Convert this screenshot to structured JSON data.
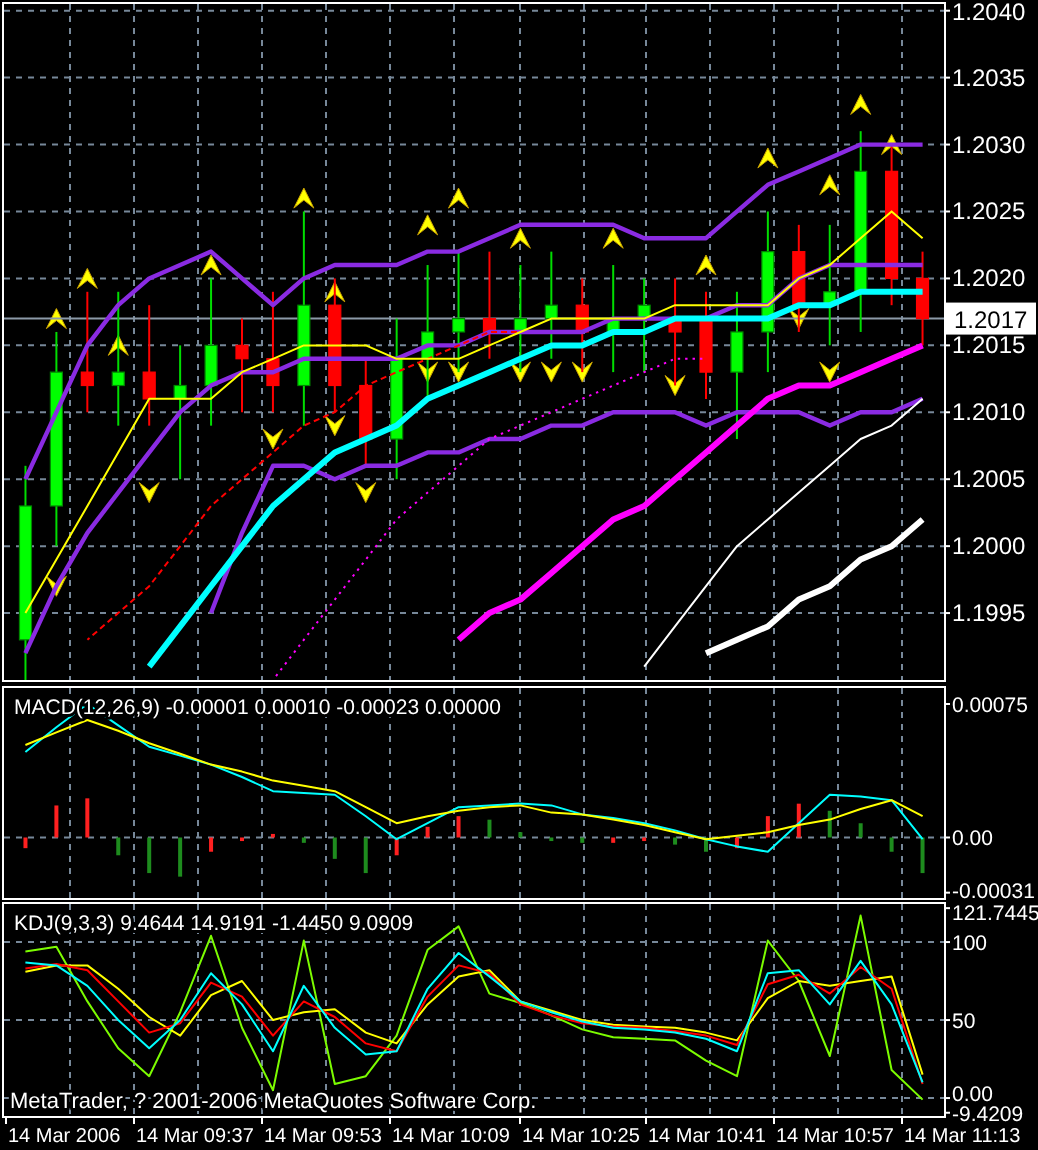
{
  "main_chart": {
    "chart_data": {
      "type": "candlestick",
      "grid": true,
      "ylim": [
        1.199,
        1.20405
      ],
      "categories": [
        null,
        null,
        null,
        null,
        null,
        null,
        null,
        null,
        null,
        null,
        null,
        null,
        null,
        null,
        null,
        null,
        null,
        null,
        null,
        null,
        null,
        null,
        null,
        null,
        null,
        null,
        null,
        null,
        null,
        null
      ],
      "yticks": [
        {
          "value": 1.204,
          "label": "1.2040"
        },
        {
          "value": 1.2035,
          "label": "1.2035"
        },
        {
          "value": 1.203,
          "label": "1.2030"
        },
        {
          "value": 1.2025,
          "label": "1.2025"
        },
        {
          "value": 1.202,
          "label": "1.2020"
        },
        {
          "value": 1.2015,
          "label": "1.2015"
        },
        {
          "value": 1.201,
          "label": "1.2010"
        },
        {
          "value": 1.2005,
          "label": "1.2005"
        },
        {
          "value": 1.2,
          "label": "1.2000"
        },
        {
          "value": 1.1995,
          "label": "1.1995"
        }
      ],
      "series": [
        {
          "ohlc": [
            [
              1.1993,
              1.2006,
              1.199,
              1.2003
            ],
            [
              1.2003,
              1.2016,
              1.2,
              1.2013
            ],
            [
              1.2013,
              1.2019,
              1.201,
              1.2012
            ],
            [
              1.2012,
              1.2019,
              1.2009,
              1.2013
            ],
            [
              1.2013,
              1.2018,
              1.2009,
              1.2011
            ],
            [
              1.2011,
              1.2015,
              1.2005,
              1.2012
            ],
            [
              1.2012,
              1.202,
              1.2009,
              1.2015
            ],
            [
              1.2015,
              1.2017,
              1.201,
              1.2014
            ],
            [
              1.2014,
              1.2019,
              1.201,
              1.2012
            ],
            [
              1.2012,
              1.2025,
              1.2009,
              1.2018
            ],
            [
              1.2018,
              1.202,
              1.201,
              1.2012
            ],
            [
              1.2012,
              1.2014,
              1.2006,
              1.2008
            ],
            [
              1.2008,
              1.2017,
              1.2005,
              1.2014
            ],
            [
              1.2014,
              1.2021,
              1.2011,
              1.2016
            ],
            [
              1.2016,
              1.2022,
              1.2013,
              1.2017
            ],
            [
              1.2017,
              1.2022,
              1.2014,
              1.2016
            ],
            [
              1.2016,
              1.2021,
              1.2013,
              1.2017
            ],
            [
              1.2017,
              1.2022,
              1.2014,
              1.2018
            ],
            [
              1.2018,
              1.202,
              1.2013,
              1.2016
            ],
            [
              1.2016,
              1.2021,
              1.2013,
              1.2017
            ],
            [
              1.2017,
              1.202,
              1.2013,
              1.2018
            ],
            [
              1.2017,
              1.202,
              1.2012,
              1.2016
            ],
            [
              1.2017,
              1.2019,
              1.2011,
              1.2013
            ],
            [
              1.2013,
              1.2019,
              1.2008,
              1.2016
            ],
            [
              1.2016,
              1.2025,
              1.2013,
              1.2022
            ],
            [
              1.2022,
              1.2024,
              1.2016,
              1.2018
            ],
            [
              1.2018,
              1.2024,
              1.2015,
              1.2019
            ],
            [
              1.2019,
              1.2031,
              1.2016,
              1.2028
            ],
            [
              1.2028,
              1.203,
              1.2018,
              1.202
            ],
            [
              1.202,
              1.2022,
              1.2015,
              1.2017
            ]
          ]
        },
        {
          "type": "line",
          "color": "#8a2be2",
          "values": [
            1.2005,
            1.201,
            1.2015,
            1.2018,
            1.202,
            1.2021,
            1.2022,
            1.202,
            1.2018,
            1.202,
            1.2021,
            1.2021,
            1.2021,
            1.2022,
            1.2022,
            1.2023,
            1.2024,
            1.2024,
            1.2024,
            1.2024,
            1.2023,
            1.2023,
            1.2023,
            1.2025,
            1.2027,
            1.2028,
            1.2029,
            1.203,
            1.203,
            1.203
          ]
        },
        {
          "type": "line",
          "color": "#8a2be2",
          "values": [
            1.1992,
            1.1997,
            1.2001,
            1.2004,
            1.2007,
            1.201,
            1.2012,
            1.2013,
            1.2013,
            1.2014,
            1.2014,
            1.2014,
            1.2014,
            1.2015,
            1.2015,
            1.2016,
            1.2016,
            1.2016,
            1.2016,
            1.2017,
            1.2017,
            1.2017,
            1.2017,
            1.2018,
            1.2018,
            1.202,
            1.2021,
            1.2021,
            1.2021,
            1.2021
          ]
        },
        {
          "type": "line",
          "color": "#8a2be2",
          "values": [
            null,
            null,
            null,
            null,
            null,
            null,
            1.1995,
            1.2001,
            1.2006,
            1.2006,
            1.2005,
            1.2006,
            1.2006,
            1.2007,
            1.2007,
            1.2008,
            1.2008,
            1.2009,
            1.2009,
            1.201,
            1.201,
            1.201,
            1.2009,
            1.201,
            1.201,
            1.201,
            1.2009,
            1.201,
            1.201,
            1.2011
          ]
        },
        {
          "type": "line",
          "line_style": "dashed",
          "color": "#ff0000",
          "values": [
            null,
            null,
            1.1993,
            1.1995,
            1.1997,
            1.2,
            1.2003,
            1.2005,
            1.2007,
            1.2009,
            1.201,
            1.2012,
            1.2013,
            1.2014,
            1.2015,
            1.2016,
            1.2016,
            null,
            null,
            null,
            null,
            null,
            null,
            null,
            null,
            null,
            null,
            null,
            null,
            null
          ]
        },
        {
          "type": "line",
          "line_style": "dotted",
          "color": "#ff00ff",
          "values": [
            null,
            null,
            null,
            null,
            null,
            null,
            null,
            null,
            1.199,
            1.1993,
            1.1996,
            1.1999,
            1.2002,
            1.2004,
            1.2006,
            1.2008,
            1.2009,
            1.201,
            1.2011,
            1.2012,
            1.2013,
            1.2014,
            1.2014,
            null,
            null,
            null,
            null,
            null,
            null,
            null
          ]
        },
        {
          "type": "line",
          "color": "#00ffff",
          "values": [
            null,
            null,
            null,
            null,
            1.1991,
            1.1994,
            1.1997,
            1.2,
            1.2003,
            1.2005,
            1.2007,
            1.2008,
            1.2009,
            1.2011,
            1.2012,
            1.2013,
            1.2014,
            1.2015,
            1.2015,
            1.2016,
            1.2016,
            1.2017,
            1.2017,
            1.2017,
            1.2017,
            1.2018,
            1.2018,
            1.2019,
            1.2019,
            1.2019
          ]
        },
        {
          "type": "line",
          "color": "#ff00ff",
          "values": [
            null,
            null,
            null,
            null,
            null,
            null,
            null,
            null,
            null,
            null,
            null,
            null,
            null,
            null,
            1.1993,
            1.1995,
            1.1996,
            1.1998,
            1.2,
            1.2002,
            1.2003,
            1.2005,
            1.2007,
            1.2009,
            1.2011,
            1.2012,
            1.2012,
            1.2013,
            1.2014,
            1.2015
          ]
        },
        {
          "type": "line",
          "color": "#ffffff",
          "values": [
            null,
            null,
            null,
            null,
            null,
            null,
            null,
            null,
            null,
            null,
            null,
            null,
            null,
            null,
            null,
            null,
            null,
            null,
            null,
            null,
            1.1991,
            1.1994,
            1.1997,
            1.2,
            1.2002,
            1.2004,
            1.2006,
            1.2008,
            1.2009,
            1.2011
          ]
        },
        {
          "type": "line",
          "color": "#ffffff",
          "values": [
            null,
            null,
            null,
            null,
            null,
            null,
            null,
            null,
            null,
            null,
            null,
            null,
            null,
            null,
            null,
            null,
            null,
            null,
            null,
            null,
            null,
            null,
            1.1992,
            1.1993,
            1.1994,
            1.1996,
            1.1997,
            1.1999,
            1.2,
            1.2002
          ]
        },
        {
          "type": "line",
          "color": "#ffff00",
          "values": [
            1.1995,
            1.1999,
            1.2003,
            1.2007,
            1.2011,
            1.2011,
            1.2011,
            1.2013,
            1.2014,
            1.2015,
            1.2015,
            1.2015,
            1.2014,
            1.2014,
            1.2014,
            1.2015,
            1.2016,
            1.2017,
            1.2017,
            1.2017,
            1.2017,
            1.2018,
            1.2018,
            1.2018,
            1.2018,
            1.202,
            1.2021,
            1.2023,
            1.2025,
            1.2023
          ]
        },
        {
          "type": "scatter",
          "color": "#ffff00",
          "values": [
            null,
            1.2017,
            1.202,
            1.2015,
            null,
            null,
            1.2021,
            null,
            null,
            1.2026,
            1.2019,
            null,
            null,
            1.2024,
            1.2026,
            null,
            1.2023,
            null,
            null,
            1.2023,
            null,
            null,
            1.2021,
            null,
            1.2029,
            null,
            1.2027,
            1.2033,
            1.203,
            null
          ]
        },
        {
          "type": "scatter",
          "color": "#ffff00",
          "values": [
            null,
            1.1997,
            null,
            null,
            1.2004,
            null,
            null,
            null,
            1.2008,
            null,
            1.2009,
            1.2004,
            null,
            1.2013,
            1.2013,
            null,
            1.2013,
            1.2013,
            1.2013,
            null,
            null,
            1.2012,
            null,
            null,
            null,
            1.2017,
            1.2013,
            null,
            null,
            null
          ]
        }
      ],
      "ref_lines": [
        {
          "axis": "y",
          "value": 1.2017,
          "label": "1.2017",
          "color": "#8c9aa8"
        }
      ]
    }
  },
  "macd_panel": {
    "title": "MACD(12,26,9) -0.00001 0.00010 -0.00023 0.00000",
    "chart_data": {
      "type": "line",
      "grid": true,
      "ylim": [
        -0.00034,
        0.00084
      ],
      "categories": [
        null,
        null,
        null,
        null,
        null,
        null,
        null,
        null,
        null,
        null,
        null,
        null,
        null,
        null,
        null,
        null,
        null,
        null,
        null,
        null,
        null,
        null,
        null,
        null,
        null,
        null,
        null,
        null,
        null,
        null
      ],
      "yticks": [
        {
          "value": 0.00075,
          "label": "0.00075"
        },
        {
          "value": 0,
          "label": "0.00"
        },
        {
          "value": -0.00031,
          "label": "-0.00031"
        }
      ],
      "series": [
        {
          "type": "bar",
          "colors": [
            "#ff2020",
            "#ff2020",
            "#ff2020",
            "#1e8c1e",
            "#1e8c1e",
            "#1e8c1e",
            "#ff2020",
            "#ff2020",
            "#ff2020",
            "#1e8c1e",
            "#1e8c1e",
            "#1e8c1e",
            "#ff2020",
            "#ff2020",
            "#ff2020",
            "#1e8c1e",
            "#1e8c1e",
            "#1e8c1e",
            "#1e8c1e",
            "#ff2020",
            "#ff2020",
            "#1e8c1e",
            "#1e8c1e",
            "#ff2020",
            "#ff2020",
            "#ff2020",
            "#1e8c1e",
            "#1e8c1e",
            "#1e8c1e",
            "#1e8c1e"
          ],
          "values": [
            -6e-05,
            0.00018,
            0.00022,
            -0.0001,
            -0.0002,
            -0.00022,
            -8e-05,
            -2e-05,
            2e-05,
            -3e-05,
            -0.00012,
            -0.0002,
            -0.0001,
            6e-05,
            0.00012,
            0.0001,
            3e-05,
            -2e-05,
            -3e-05,
            -3e-05,
            -2e-05,
            -4e-05,
            -8e-05,
            -6e-05,
            0.00012,
            0.00019,
            0.00015,
            8e-05,
            -8e-05,
            -0.0002
          ]
        },
        {
          "color": "#00ffff",
          "values": [
            0.00048,
            0.00062,
            0.00075,
            0.00063,
            0.00051,
            0.00046,
            0.00041,
            0.00034,
            0.00026,
            0.00025,
            0.00024,
            0.00012,
            -1e-05,
            8e-05,
            0.00017,
            0.00018,
            0.00019,
            0.00018,
            0.00013,
            0.00011,
            8e-05,
            4e-05,
            -1e-05,
            -5e-05,
            -8e-05,
            8e-05,
            0.00024,
            0.00023,
            0.00021,
            -1e-05
          ]
        },
        {
          "color": "#ffff00",
          "values": [
            0.00052,
            0.00059,
            0.00066,
            0.0006,
            0.00053,
            0.00047,
            0.00041,
            0.00037,
            0.00032,
            0.00029,
            0.00026,
            0.00017,
            8e-05,
            0.00012,
            0.00015,
            0.00017,
            0.00018,
            0.00014,
            0.00013,
            0.0001,
            7e-05,
            3e-05,
            -1e-05,
            1e-05,
            3e-05,
            7e-05,
            0.0001,
            0.00016,
            0.00021,
            0.00012
          ]
        }
      ]
    }
  },
  "kdj_panel": {
    "title": "KDJ(9,3,3) 9.4644 14.9191 -1.4450 9.0909",
    "copyright": "MetaTrader, ? 2001-2006 MetaQuotes Software Corp.",
    "chart_data": {
      "type": "line",
      "grid": true,
      "ylim": [
        -11.5,
        124.4
      ],
      "categories": [
        null,
        null,
        null,
        null,
        null,
        null,
        null,
        null,
        null,
        null,
        null,
        null,
        null,
        null,
        null,
        null,
        null,
        null,
        null,
        null,
        null,
        null,
        null,
        null,
        null,
        null,
        null,
        null,
        null,
        null
      ],
      "yticks": [
        {
          "value": 121.7445,
          "label": "121.7445"
        },
        {
          "value": 100,
          "label": "100"
        },
        {
          "value": 50,
          "label": "50"
        },
        {
          "value": 0,
          "label": "0.00"
        },
        {
          "value": -9.4209,
          "label": "-9.4209"
        }
      ],
      "series": [
        {
          "color": "#7cfc00",
          "values": [
            94,
            97,
            62,
            32,
            14,
            55,
            104,
            45,
            5,
            101,
            9,
            14,
            40,
            95,
            110,
            67,
            61,
            53,
            44,
            39,
            38,
            37,
            24,
            14,
            101,
            75,
            27,
            117,
            18,
            -1
          ]
        },
        {
          "color": "#ffff00",
          "values": [
            81,
            85,
            85,
            70,
            52,
            40,
            66,
            75,
            50,
            55,
            57,
            42,
            35,
            60,
            78,
            82,
            62,
            56,
            50,
            47,
            46,
            45,
            42,
            37,
            64,
            75,
            72,
            75,
            78,
            15
          ]
        },
        {
          "color": "#ff0000",
          "values": [
            83,
            86,
            82,
            62,
            42,
            48,
            74,
            65,
            40,
            62,
            52,
            35,
            30,
            65,
            85,
            80,
            60,
            53,
            48,
            46,
            45,
            43,
            40,
            34,
            73,
            79,
            67,
            84,
            70,
            9
          ]
        },
        {
          "color": "#00ffff",
          "values": [
            87,
            85,
            72,
            50,
            32,
            50,
            80,
            60,
            30,
            72,
            45,
            28,
            30,
            70,
            93,
            78,
            62,
            55,
            49,
            45,
            44,
            42,
            38,
            30,
            80,
            82,
            60,
            88,
            60,
            10
          ]
        }
      ]
    }
  },
  "time_axis": {
    "labels": [
      "14 Mar 2006",
      "14 Mar 09:37",
      "14 Mar 09:53",
      "14 Mar 10:09",
      "14 Mar 10:25",
      "14 Mar 10:41",
      "14 Mar 10:57",
      "14 Mar 11:13"
    ]
  }
}
